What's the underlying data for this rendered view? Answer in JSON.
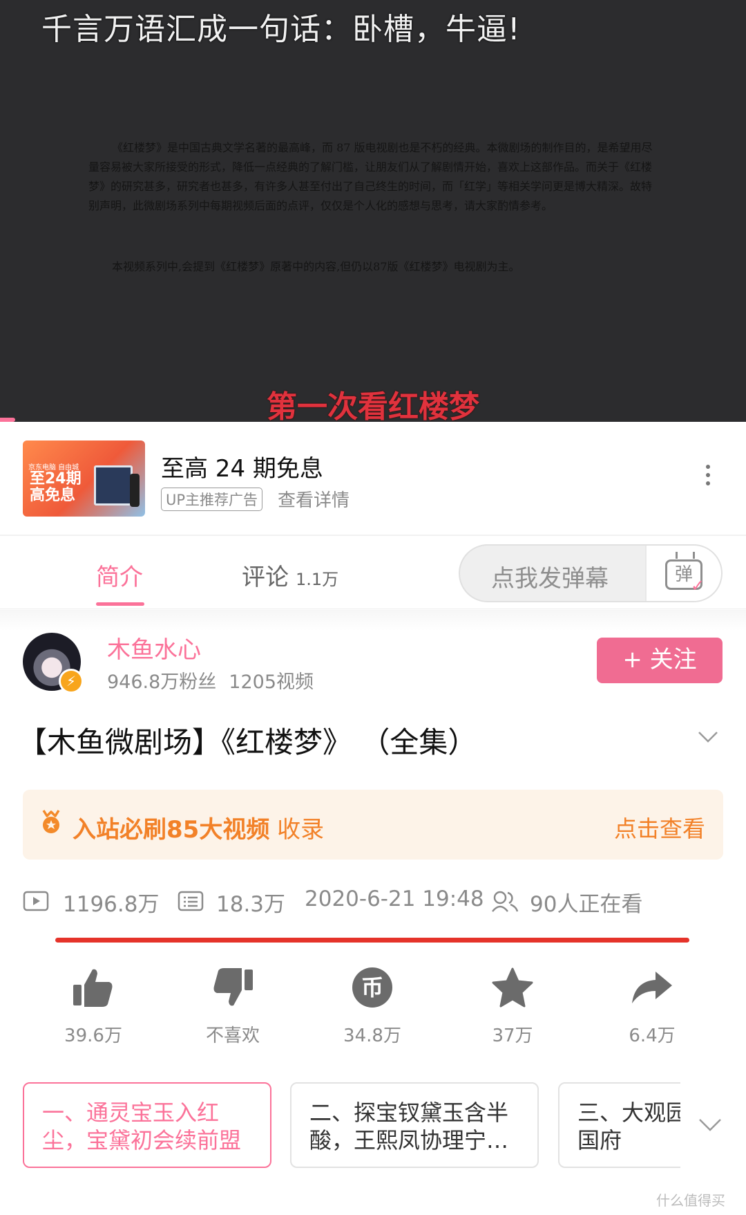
{
  "player": {
    "danmaku": "千言万语汇成一句话：卧槽，牛逼!",
    "intro_paragraph": "《红楼梦》是中国古典文学名著的最高峰，而 87 版电视剧也是不朽的经典。本微剧场的制作目的，是希望用尽量容易被大家所接受的形式，降低一点经典的了解门槛，让朋友们从了解剧情开始，喜欢上这部作品。而关于《红楼梦》的研究甚多，研究者也甚多，有许多人甚至付出了自己终生的时间，而「红学」等相关学问更是博大精深。故特别声明，此微剧场系列中每期视频后面的点评，仅仅是个人化的感想与思考，请大家酌情参考。",
    "intro_note": "本视频系列中,会提到《红楼梦》原著中的内容,但仍以87版《红楼梦》电视剧为主。",
    "subtitle": "第一次看红楼梦",
    "progress_fraction": 0.02
  },
  "ad": {
    "thumb_small": "京东电脑 自由城",
    "thumb_big": "至24期\n高免息",
    "title": "至高 24 期免息",
    "tag": "UP主推荐广告",
    "detail": "查看详情"
  },
  "tabs": {
    "intro": "简介",
    "comments": "评论",
    "comments_count": "1.1万",
    "danmaku_placeholder": "点我发弹幕",
    "danmaku_icon_char": "弹"
  },
  "author": {
    "name": "木鱼水心",
    "fans": "946.8万粉丝",
    "videos": "1205视频",
    "follow": "+ 关注"
  },
  "video": {
    "title": "【木鱼微剧场】《红楼梦》 （全集）"
  },
  "collection": {
    "label_bold": "入站必刷85大视频",
    "label_rest": " 收录",
    "action": "点击查看"
  },
  "meta": {
    "plays": "1196.8万",
    "danmaku": "18.3万",
    "date": "2020-6-21 19:48",
    "watching": "90人正在看"
  },
  "actions": {
    "like": "39.6万",
    "dislike": "不喜欢",
    "coin": "34.8万",
    "favorite": "37万",
    "share": "6.4万"
  },
  "episodes": [
    {
      "title": "一、通灵宝玉入红尘，宝黛初会续前盟"
    },
    {
      "title": "二、探宝钗黛玉含半酸，王熙凤协理宁…"
    },
    {
      "title": "三、大观园题额，荣国府"
    }
  ],
  "watermark": "什么值得买",
  "colors": {
    "accent": "#fb7299",
    "orange": "#f28128",
    "redline": "#e5332a"
  }
}
